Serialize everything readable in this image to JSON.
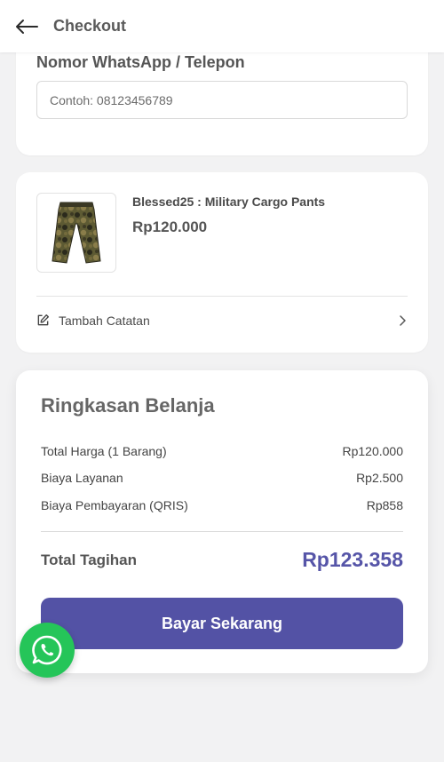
{
  "header": {
    "title": "Checkout",
    "back_icon": "arrow-left-icon"
  },
  "contact": {
    "label": "Nomor WhatsApp / Telepon",
    "placeholder": "Contoh: 08123456789",
    "value": ""
  },
  "product": {
    "name": "Blessed25 : Military Cargo Pants",
    "price": "Rp120.000",
    "image_icon": "camo-pants-image",
    "note_label": "Tambah Catatan"
  },
  "summary": {
    "title": "Ringkasan Belanja",
    "rows": [
      {
        "label": "Total Harga (1 Barang)",
        "value": "Rp120.000"
      },
      {
        "label": "Biaya Layanan",
        "value": "Rp2.500"
      },
      {
        "label": "Biaya Pembayaran (QRIS)",
        "value": "Rp858"
      }
    ],
    "total_label": "Total Tagihan",
    "total_value": "Rp123.358",
    "pay_button": "Bayar Sekarang"
  },
  "colors": {
    "accent": "#5352a5",
    "total_text": "#5655a8",
    "whatsapp": "#25c559",
    "background": "#f2f2f3"
  }
}
